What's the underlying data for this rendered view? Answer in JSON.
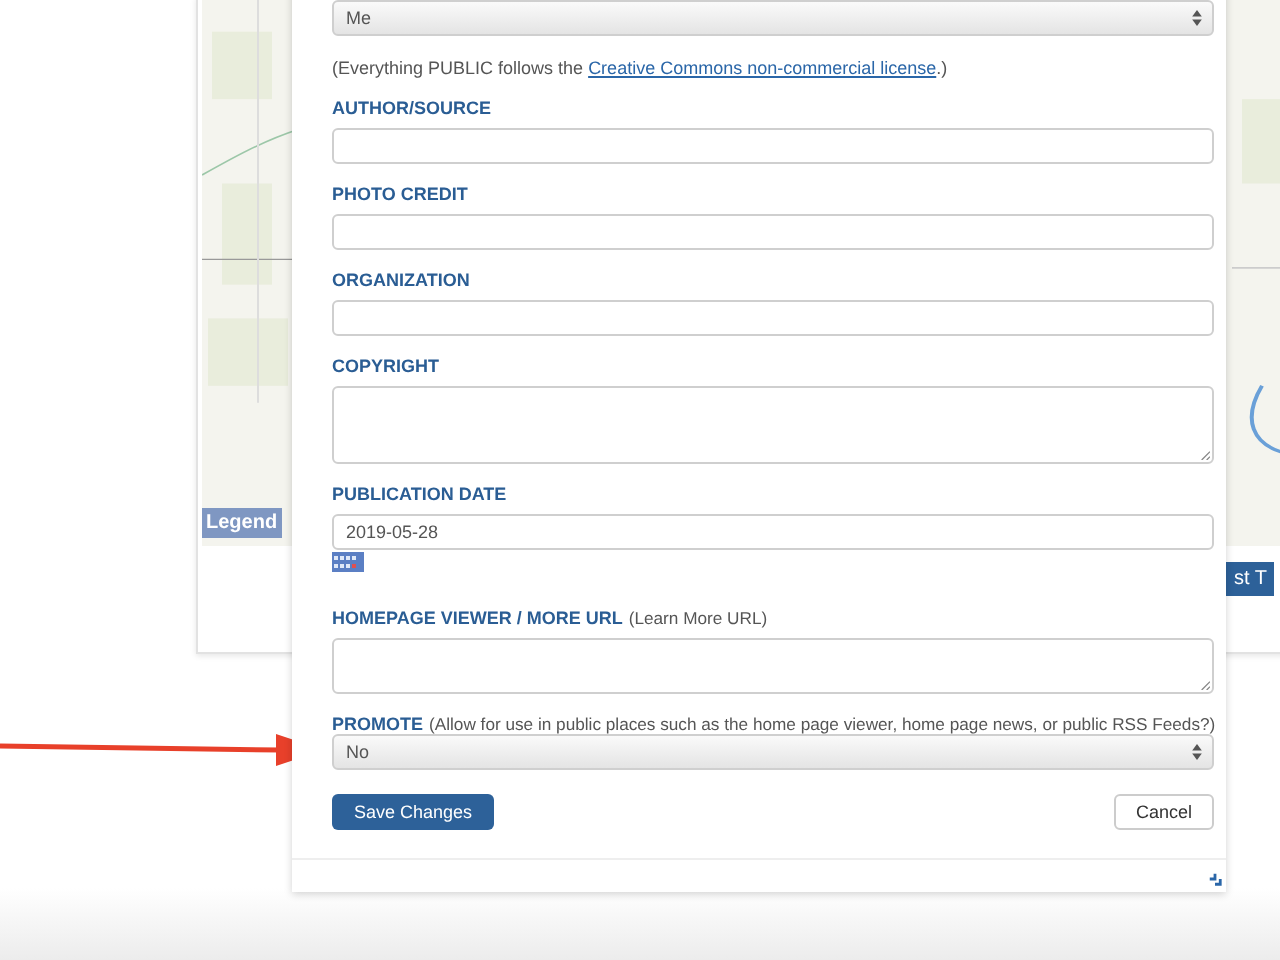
{
  "background_map": {
    "legend_button": "Legend",
    "side_button": "st T"
  },
  "form": {
    "owner_select": {
      "value": "Me"
    },
    "license_note": {
      "text_before": "(Everything PUBLIC follows the ",
      "link": "Creative Commons non-commercial license",
      "text_after": ".)"
    },
    "fields": [
      {
        "label": "AUTHOR/SOURCE",
        "kind": "input"
      },
      {
        "label": "PHOTO CREDIT",
        "kind": "input"
      },
      {
        "label": "ORGANIZATION",
        "kind": "input"
      },
      {
        "label": "COPYRIGHT",
        "kind": "textarea"
      },
      {
        "label": "PUBLICATION DATE",
        "kind": "date",
        "value": "2019-05-28"
      },
      {
        "label": "HOMEPAGE VIEWER / MORE URL",
        "hint": "(Learn More URL)",
        "kind": "url"
      },
      {
        "label": "PROMOTE",
        "hint": "(Allow for use in public places such as the home page viewer, home page news, or public RSS Feeds?)",
        "kind": "select",
        "value": "No"
      }
    ],
    "buttons": {
      "save": "Save Changes",
      "cancel": "Cancel"
    }
  }
}
